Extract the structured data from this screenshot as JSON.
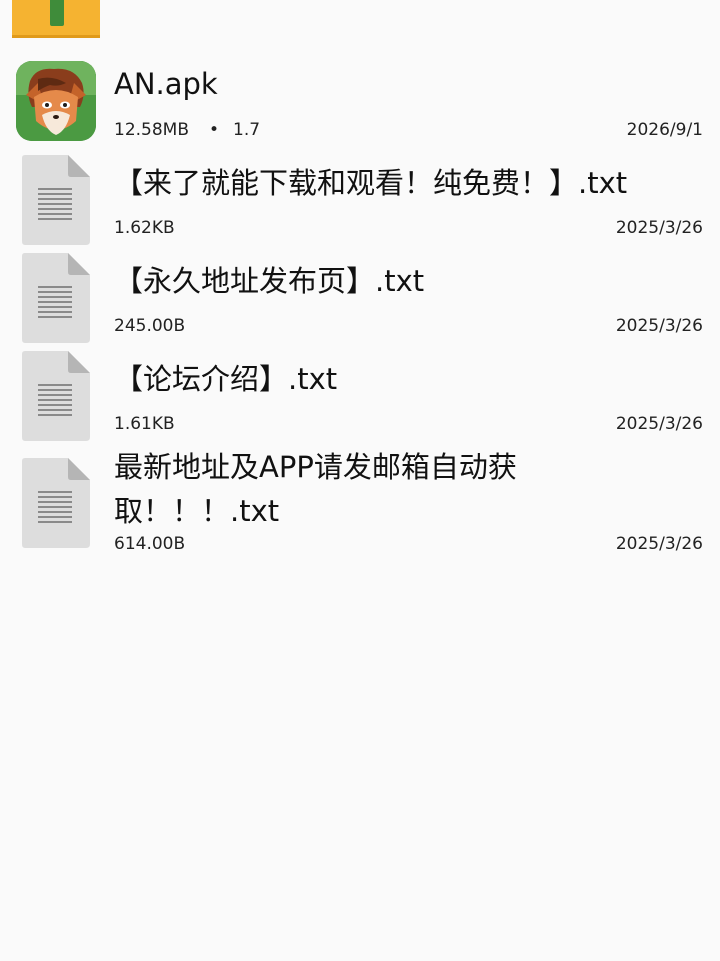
{
  "files": [
    {
      "name": "AN.apk",
      "size": "12.58MB",
      "separator": "•",
      "version": "1.7",
      "date": "2026/9/1",
      "icon": "app-icon"
    },
    {
      "name": "【来了就能下载和观看！纯免费！】.txt",
      "size": "1.62KB",
      "date": "2025/3/26",
      "icon": "text-file-icon"
    },
    {
      "name": "【永久地址发布页】.txt",
      "size": "245.00B",
      "date": "2025/3/26",
      "icon": "text-file-icon"
    },
    {
      "name": "【论坛介绍】.txt",
      "size": "1.61KB",
      "date": "2025/3/26",
      "icon": "text-file-icon"
    },
    {
      "name": "最新地址及APP请发邮箱自动获取！！！.txt",
      "size": "614.00B",
      "date": "2025/3/26",
      "icon": "text-file-icon"
    }
  ],
  "colors": {
    "background": "#fafafa",
    "folder": "#f5b331",
    "folder_plus": "#3f8c3a",
    "doc_icon": "#dddddd",
    "doc_lines": "#8a8a8a"
  }
}
